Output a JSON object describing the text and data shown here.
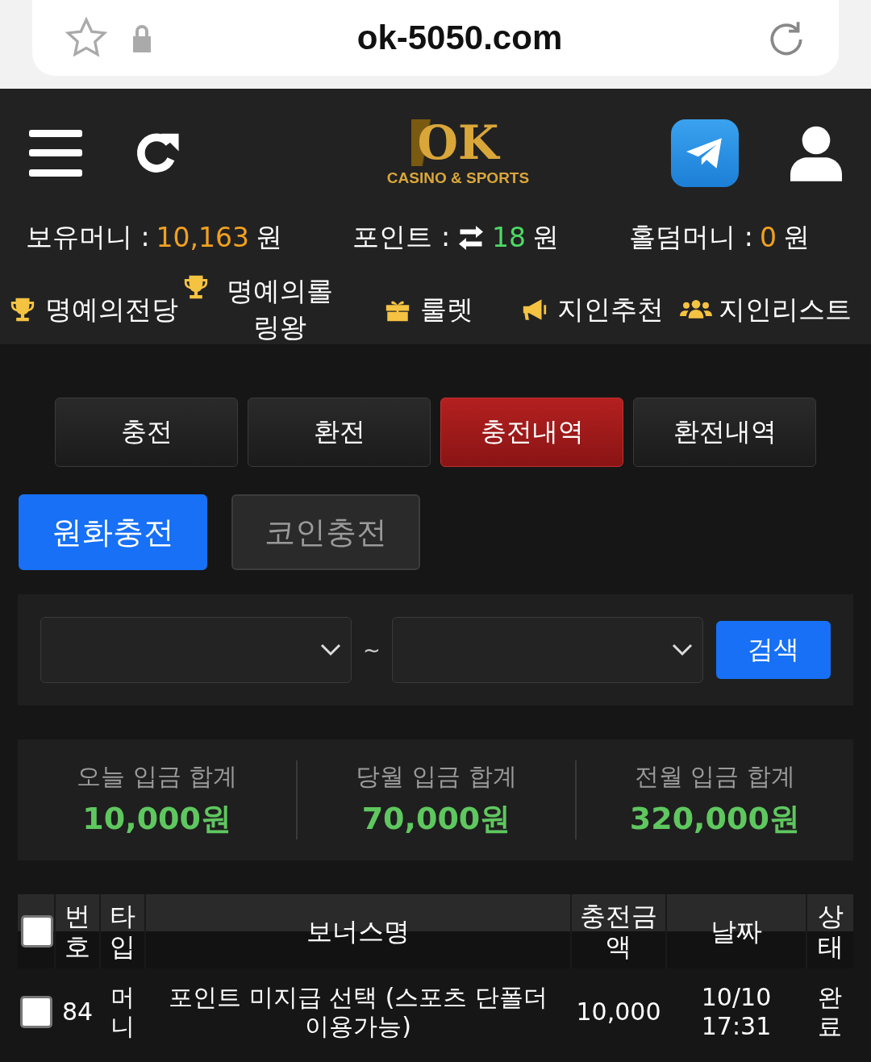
{
  "browser": {
    "url": "ok-5050.com"
  },
  "logo": {
    "mark": "OK",
    "tagline": "CASINO & SPORTS"
  },
  "balances": [
    {
      "label": "보유머니 :",
      "value": "10,163",
      "unit": "원",
      "color": "#f0a020",
      "kind": "plain"
    },
    {
      "label": "포인트 :",
      "value": "18",
      "unit": "원",
      "color": "#4cd964",
      "kind": "exchange"
    },
    {
      "label": "홀덤머니 :",
      "value": "0",
      "unit": "원",
      "color": "#f0a020",
      "kind": "plain"
    }
  ],
  "nav": [
    {
      "label": "명예의전당",
      "kind": "trophy"
    },
    {
      "label": "명예의롤링왕",
      "kind": "trophy"
    },
    {
      "label": "룰렛",
      "kind": "gift"
    },
    {
      "label": "지인추천",
      "kind": "megaphone"
    },
    {
      "label": "지인리스트",
      "kind": "users"
    }
  ],
  "main_tabs": [
    {
      "label": "충전",
      "selected": false
    },
    {
      "label": "환전",
      "selected": false
    },
    {
      "label": "충전내역",
      "selected": true
    },
    {
      "label": "환전내역",
      "selected": false
    }
  ],
  "sub_tabs": [
    {
      "label": "원화충전",
      "selected": true
    },
    {
      "label": "코인충전",
      "selected": false
    }
  ],
  "filter": {
    "separator": "~",
    "search_button": "검색"
  },
  "totals": [
    {
      "label": "오늘 입금 합계",
      "value": "10,000원"
    },
    {
      "label": "당월 입금 합계",
      "value": "70,000원"
    },
    {
      "label": "전월 입금 합계",
      "value": "320,000원"
    }
  ],
  "table": {
    "columns": [
      "번호",
      "타입",
      "보너스명",
      "충전금액",
      "날짜",
      "상태"
    ],
    "all_checked": false,
    "rows": [
      {
        "checked": false,
        "cells": [
          "84",
          "머니",
          "포인트 미지급 선택 (스포츠 단폴더 이용가능)",
          "10,000",
          "10/10 17:31",
          "완료"
        ]
      }
    ]
  }
}
